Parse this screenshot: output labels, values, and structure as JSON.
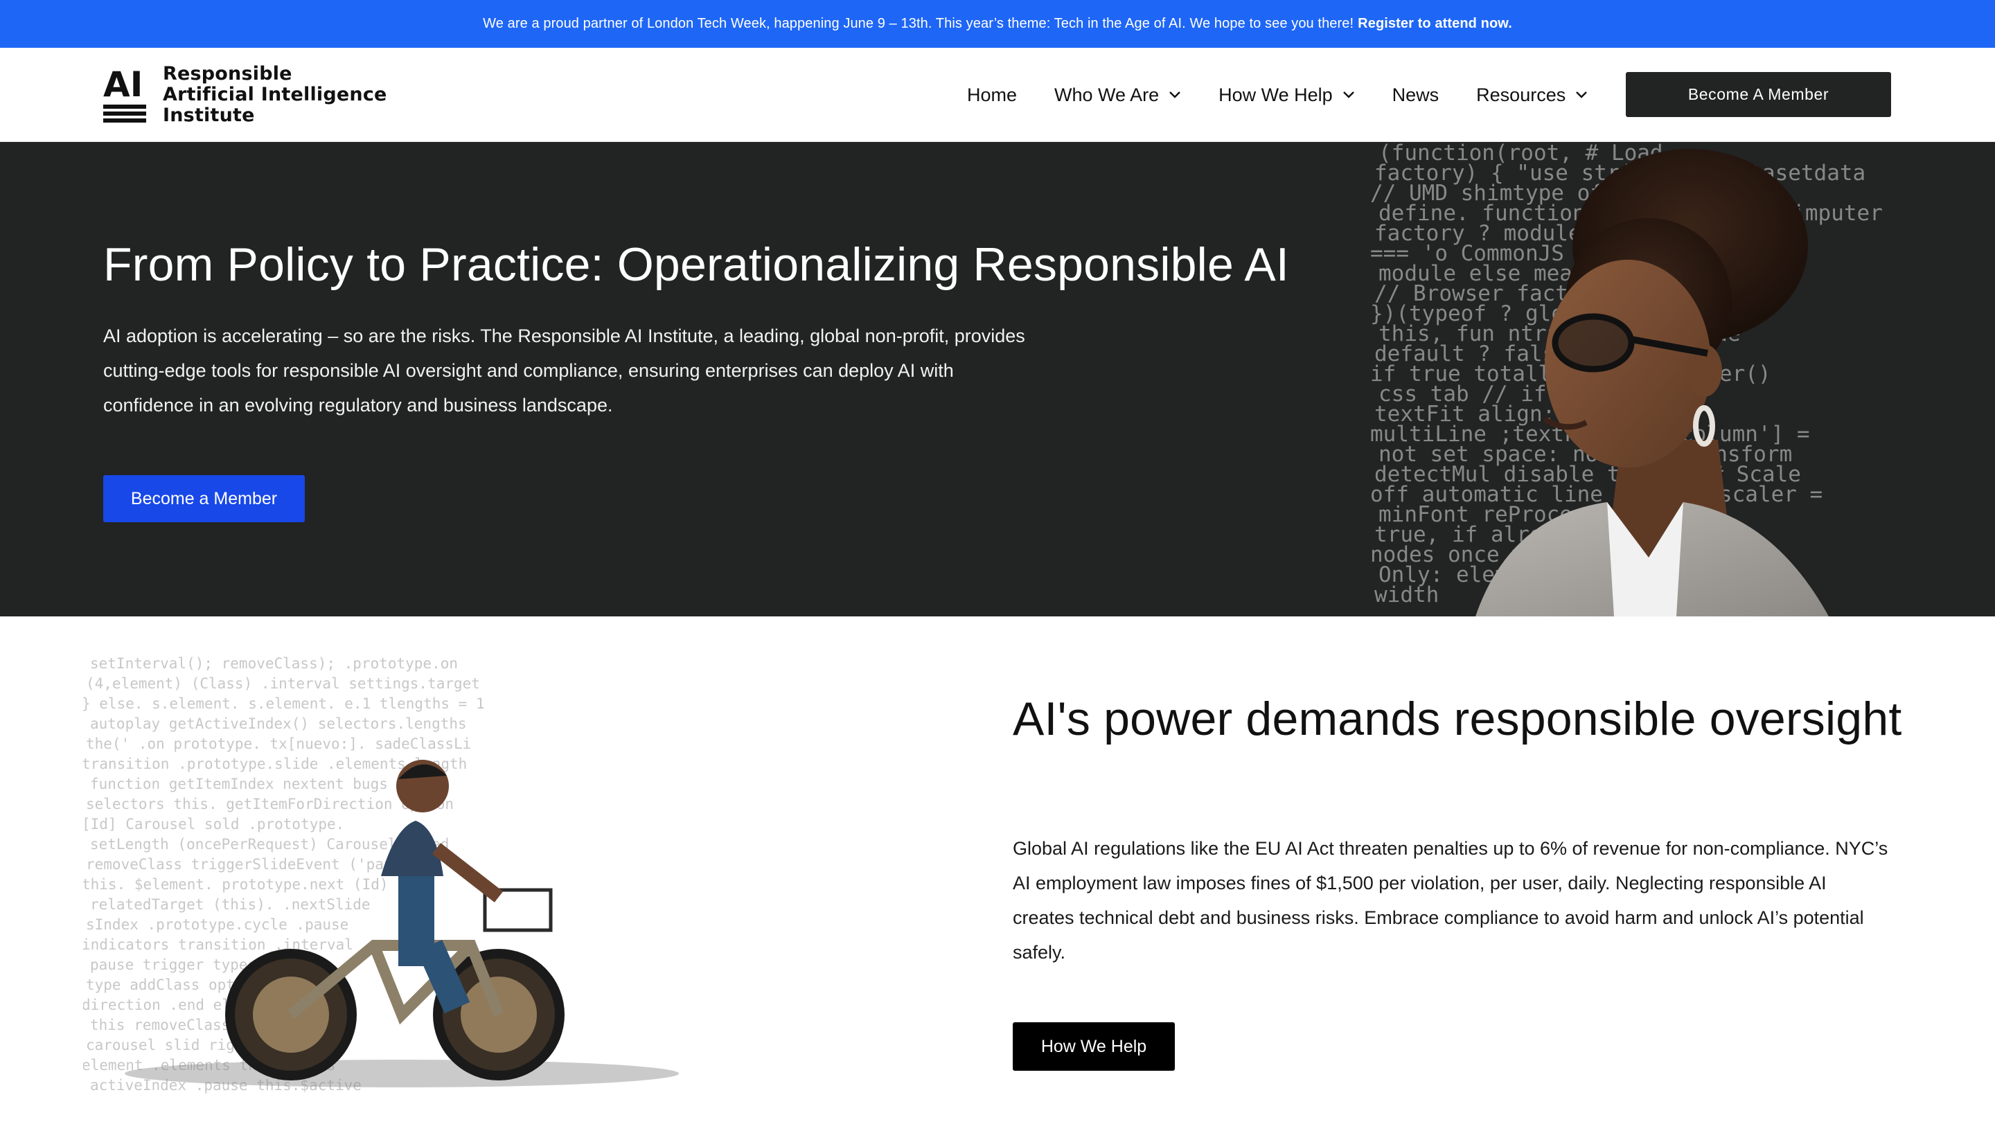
{
  "announcement": {
    "message": "We are a proud partner of London Tech Week, happening June 9 – 13th. This year’s theme: Tech in the Age of AI. We hope to see you there!",
    "link": "Register to attend now."
  },
  "header": {
    "logo": {
      "mark": "AI",
      "lines": [
        "Responsible",
        "Artificial Intelligence",
        "Institute"
      ]
    },
    "nav": [
      {
        "label": "Home",
        "has_dropdown": false
      },
      {
        "label": "Who We Are",
        "has_dropdown": true
      },
      {
        "label": "How We Help",
        "has_dropdown": true
      },
      {
        "label": "News",
        "has_dropdown": false
      },
      {
        "label": "Resources",
        "has_dropdown": true
      }
    ],
    "cta_label": "Become A Member"
  },
  "hero": {
    "title": "From Policy to Practice: Operationalizing Responsible AI",
    "body": "AI adoption is accelerating – so are the risks. The Responsible AI Institute, a leading, global non-profit, provides cutting-edge tools for responsible AI oversight and compliance, ensuring enterprises can deploy AI with confidence in an evolving regulatory and business landscape.",
    "button_label": "Become a Member",
    "code_lines": [
      "(function(root,  # Load",
      "factory) { \"use strict\";thedatasetdata",
      "// UMD shimtype of de  aset.csv')",
      "define.  function\"&&  define(ll a imputer",
      "factory  ? module.exports",
      "=== 'o  CommonJS",
      "module  else  mean')data",
      "// Browser  factory(); transform",
      "})(typeof  ? global :",
      "this, fun  ntractive  # Encode",
      "default  ? false,  encoder =",
      "if true  totally using  encoder()",
      "css tab  // if true,",
      "textFit  align: center",
      "multiLine  ;textFit will  column'] =",
      "not set  space: no-wrap  transform",
      "detectMul  disable to turn  # Scale",
      "off automatic  line sensing  scaler =",
      "minFont  reProcess:  Scaler()",
      "true, if  already-fit  scaler.",
      "nodes  once width  e",
      "Only:  element  ve the",
      "width  "
    ]
  },
  "oversight": {
    "title": "AI's power demands responsible oversight",
    "body": "Global AI regulations like the EU AI Act threaten penalties up to 6% of revenue for non-compliance. NYC’s AI employment law imposes fines of $1,500 per violation, per user, daily. Neglecting responsible AI creates technical debt and business risks. Embrace compliance to avoid harm and unlock AI’s potential safely.",
    "button_label": "How We Help",
    "code_lines": [
      "setInterval();  removeClass);  .prototype.on",
      "(4,element)  (Class)  .interval  settings.target",
      "} else.  s.element.  s.element.  e.1  tlengths = 1",
      "autoplay  getActiveIndex()  selectors.lengths",
      "the(' .on  prototype.  tx[nuevo:].  sadeClassLi",
      "transition  .prototype.slide  .elements  length",
      "function  getItemIndex  nextent  bugs  .next",
      "selectors  this.  getItemForDirection  option",
      "[Id]  Carousel  sold  .prototype.",
      "setLength  (oncePerRequest)  Carousel.fixed",
      "removeClass  triggerSlideEvent  ('pause');",
      "this.  $element.  prototype.next  (Id)",
      "relatedTarget  (this).  .nextSlide",
      "sIndex  .prototype.cycle  .pause",
      "indicators  transition  .interval",
      "pause  trigger  typeof  data",
      "type  addClass  option  var",
      "direction  .end  element  .active",
      "this  removeClass  slide",
      "carousel  slid  rightItem  .item",
      "element  .elements  this.$items",
      "activeIndex  .pause  this.$active"
    ]
  },
  "colors": {
    "announcement_bg": "#1e66f5",
    "header_bg": "#ffffff",
    "hero_bg": "#222323",
    "primary_button": "#1848e8",
    "dark_button": "#000000",
    "header_cta": "#222323"
  },
  "icons": {
    "nav_dropdown": "chevron-down-icon",
    "logo": "ai-logo-icon"
  }
}
